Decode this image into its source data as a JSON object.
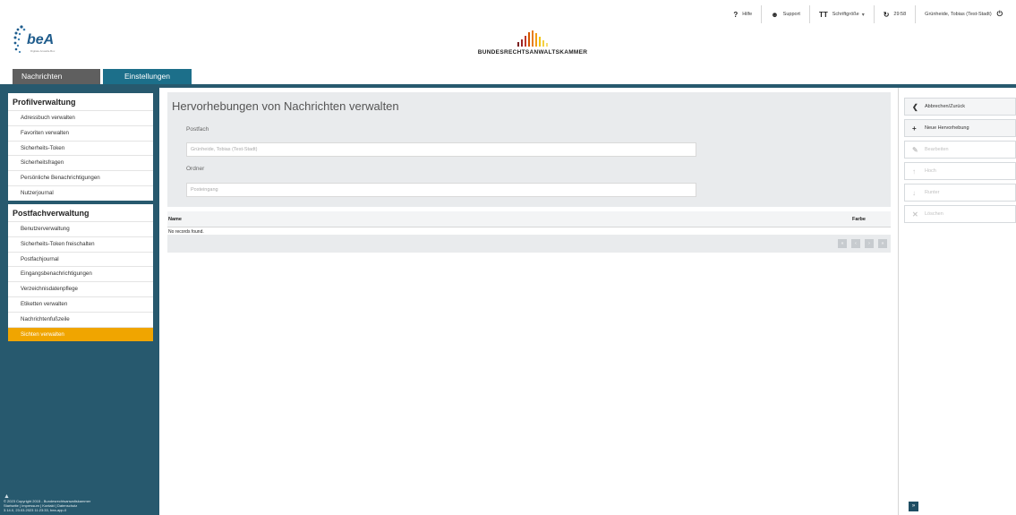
{
  "topbar": {
    "help": "Hilfe",
    "support": "Support",
    "font_size": "Schriftgröße",
    "timer": "29:58",
    "user": "Grünheide, Tobias (Test-Stadt)"
  },
  "brand": {
    "logo_text": "beA",
    "logo_sub": "Digitale Anwalts-Box",
    "chamber": "BUNDESRECHTSANWALTSKAMMER"
  },
  "tabs": [
    "Nachrichten",
    "Einstellungen"
  ],
  "sidebar": {
    "profile": {
      "title": "Profilverwaltung",
      "items": [
        "Adressbuch verwalten",
        "Favoriten verwalten",
        "Sicherheits-Token",
        "Sicherheitsfragen",
        "Persönliche Benachrichtigungen",
        "Nutzerjournal"
      ]
    },
    "postfach": {
      "title": "Postfachverwaltung",
      "items": [
        "Benutzerverwaltung",
        "Sicherheits-Token freischalten",
        "Postfachjournal",
        "Eingangsbenachrichtigungen",
        "Verzeichnisdatenpflege",
        "Etiketten verwalten",
        "Nachrichtenfußzeile",
        "Sichten verwalten"
      ]
    },
    "footer": {
      "copyright": "© 2023 Copyright 2015 - Bundesrechtsanwaltskammer",
      "links": "Startseite | Impressum | Kontakt | Datenschutz",
      "version": "3.14.0, 23.03.2023 11:23:33, bea-app-0"
    }
  },
  "content": {
    "title": "Hervorhebungen von Nachrichten verwalten",
    "postfach_label": "Postfach",
    "postfach_value": "Grünheide, Tobias (Test-Stadt)",
    "ordner_label": "Ordner",
    "ordner_value": "Posteingang",
    "table": {
      "col_name": "Name",
      "col_farbe": "Farbe",
      "empty": "No records found."
    },
    "pager": [
      "«",
      "‹",
      "›",
      "»"
    ]
  },
  "actions": [
    {
      "label": "Abbrechen/Zurück",
      "icon": "back-icon",
      "enabled": true
    },
    {
      "label": "Neue Hervorhebung",
      "icon": "plus-icon",
      "enabled": true
    },
    {
      "label": "Bearbeiten",
      "icon": "pencil-icon",
      "enabled": false
    },
    {
      "label": "Hoch",
      "icon": "arrow-up-icon",
      "enabled": false
    },
    {
      "label": "Runter",
      "icon": "arrow-down-icon",
      "enabled": false
    },
    {
      "label": "Löschen",
      "icon": "close-icon",
      "enabled": false
    }
  ],
  "colors": {
    "sidebar_bg": "#27596e",
    "active_item": "#f0a500",
    "active_tab": "#1c6f8a"
  }
}
